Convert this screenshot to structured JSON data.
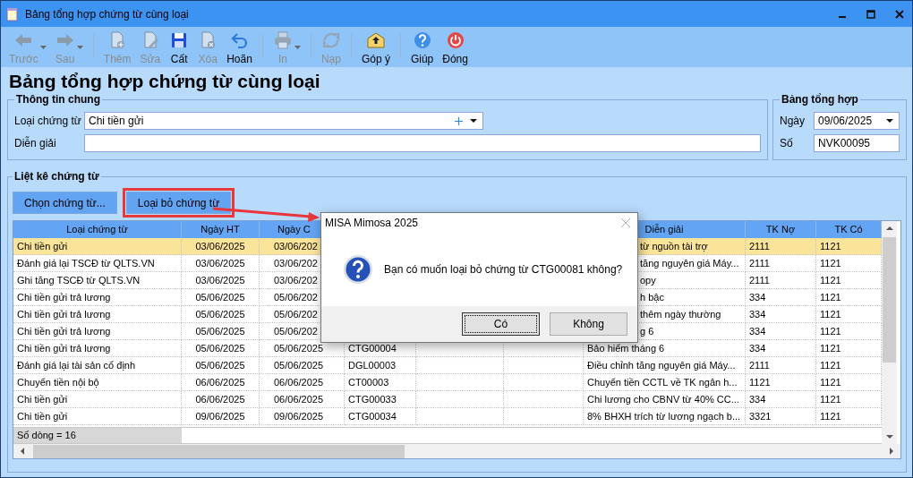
{
  "window": {
    "title": "Bảng tổng hợp chứng từ cùng loại"
  },
  "toolbar": [
    {
      "kind": "button",
      "label": "Trước",
      "disabled": true,
      "dropdown": true
    },
    {
      "kind": "button",
      "label": "Sau",
      "disabled": true,
      "dropdown": true
    },
    {
      "kind": "separator"
    },
    {
      "kind": "button",
      "label": "Thêm",
      "disabled": true,
      "dropdown": false
    },
    {
      "kind": "button",
      "label": "Sửa",
      "disabled": true,
      "dropdown": false
    },
    {
      "kind": "button",
      "label": "Cất",
      "disabled": false,
      "dropdown": false
    },
    {
      "kind": "button",
      "label": "Xóa",
      "disabled": true,
      "dropdown": false
    },
    {
      "kind": "button",
      "label": "Hoãn",
      "disabled": false,
      "dropdown": false
    },
    {
      "kind": "separator"
    },
    {
      "kind": "button",
      "label": "In",
      "disabled": true,
      "dropdown": true
    },
    {
      "kind": "separator"
    },
    {
      "kind": "button",
      "label": "Nạp",
      "disabled": true,
      "dropdown": false
    },
    {
      "kind": "separator"
    },
    {
      "kind": "button",
      "label": "Góp ý",
      "disabled": false,
      "dropdown": false
    },
    {
      "kind": "separator"
    },
    {
      "kind": "button",
      "label": "Giúp",
      "disabled": false,
      "dropdown": false
    },
    {
      "kind": "button",
      "label": "Đóng",
      "disabled": false,
      "dropdown": false
    }
  ],
  "heading": "Bảng tổng hợp chứng từ cùng loại",
  "general_info": {
    "title": "Thông tin chung",
    "fields": [
      {
        "kind": "lookup",
        "label": "Loại chứng từ",
        "value": "Chi tiền gửi"
      },
      {
        "kind": "text",
        "label": "Diễn giải"
      }
    ]
  },
  "summary": {
    "title": "Bảng tổng hợp",
    "fields": [
      {
        "kind": "date",
        "label": "Ngày",
        "value": "09/06/2025"
      },
      {
        "kind": "text",
        "label": "Số",
        "value": "NVK00095"
      }
    ]
  },
  "documents": {
    "title": "Liệt kê chứng từ",
    "buttons": [
      {
        "label": "Chọn chứng từ...",
        "highlighted": false
      },
      {
        "label": "Loại bỏ chứng từ",
        "highlighted": true
      }
    ],
    "table": {
      "columns": [
        {
          "label": "Loại chứng từ"
        },
        {
          "label": "Ngày HT"
        },
        {
          "label": "Ngày C"
        },
        {
          "label": "Diễn giải"
        },
        {
          "label": "TK Nợ"
        },
        {
          "label": "TK Có"
        }
      ],
      "rows": [
        {
          "kind": "under_dialog",
          "selected": true,
          "cells": [
            "Chi tiền gửi",
            "03/06/2025",
            "03/06/202",
            "từ nguồn tài trợ",
            "2111",
            "1121"
          ]
        },
        {
          "kind": "under_dialog",
          "selected": false,
          "cells": [
            "Đánh giá lại TSCĐ từ QLTS.VN",
            "03/06/2025",
            "03/06/202",
            "tăng nguyên giá Máy...",
            "2111",
            "1121"
          ]
        },
        {
          "kind": "under_dialog",
          "selected": false,
          "cells": [
            "Ghi tăng TSCĐ từ QLTS.VN",
            "03/06/2025",
            "03/06/202",
            "opy",
            "2111",
            "1121"
          ]
        },
        {
          "kind": "under_dialog",
          "selected": false,
          "cells": [
            "Chi tiền gửi trả lương",
            "05/06/2025",
            "05/06/202",
            "h bậc",
            "334",
            "1121"
          ]
        },
        {
          "kind": "under_dialog",
          "selected": false,
          "cells": [
            "Chi tiền gửi trả lương",
            "05/06/2025",
            "05/06/202",
            "thêm ngày thường",
            "334",
            "1121"
          ]
        },
        {
          "kind": "under_dialog",
          "selected": false,
          "cells": [
            "Chi tiền gửi trả lương",
            "05/06/2025",
            "05/06/202",
            "g 6",
            "334",
            "1121"
          ]
        },
        {
          "kind": "full",
          "selected": false,
          "cells": [
            "Chi tiền gửi trả lương",
            "05/06/2025",
            "05/06/2025",
            "CTG00004",
            "Bảo hiểm tháng 6",
            "334",
            "1121"
          ]
        },
        {
          "kind": "full",
          "selected": false,
          "cells": [
            "Đánh giá lại tài sản cố định",
            "05/06/2025",
            "05/06/2025",
            "DGL00003",
            "Điều chỉnh tăng nguyên giá Máy...",
            "2111",
            "1121"
          ]
        },
        {
          "kind": "full",
          "selected": false,
          "cells": [
            "Chuyển tiền nội bộ",
            "06/06/2025",
            "06/06/2025",
            "CT00003",
            "Chuyển tiền CCTL về TK ngân h...",
            "1121",
            "1121"
          ]
        },
        {
          "kind": "full",
          "selected": false,
          "cells": [
            "Chi tiền gửi",
            "06/06/2025",
            "06/06/2025",
            "CTG00033",
            "Chi lương cho CBNV từ 40% CC...",
            "334",
            "1121"
          ]
        },
        {
          "kind": "full",
          "selected": false,
          "cells": [
            "Chi tiền gửi",
            "09/06/2025",
            "09/06/2025",
            "CTG00034",
            "8% BHXH trích từ lương ngạch b...",
            "3321",
            "1121"
          ]
        }
      ]
    },
    "row_count": "Số dòng = 16"
  },
  "dialog": {
    "title": "MISA Mimosa 2025",
    "message": "Bạn có muốn loại bỏ chứng từ CTG00081 không?",
    "buttons": [
      {
        "label": "Có",
        "focused": true
      },
      {
        "label": "Không",
        "focused": false
      }
    ]
  }
}
